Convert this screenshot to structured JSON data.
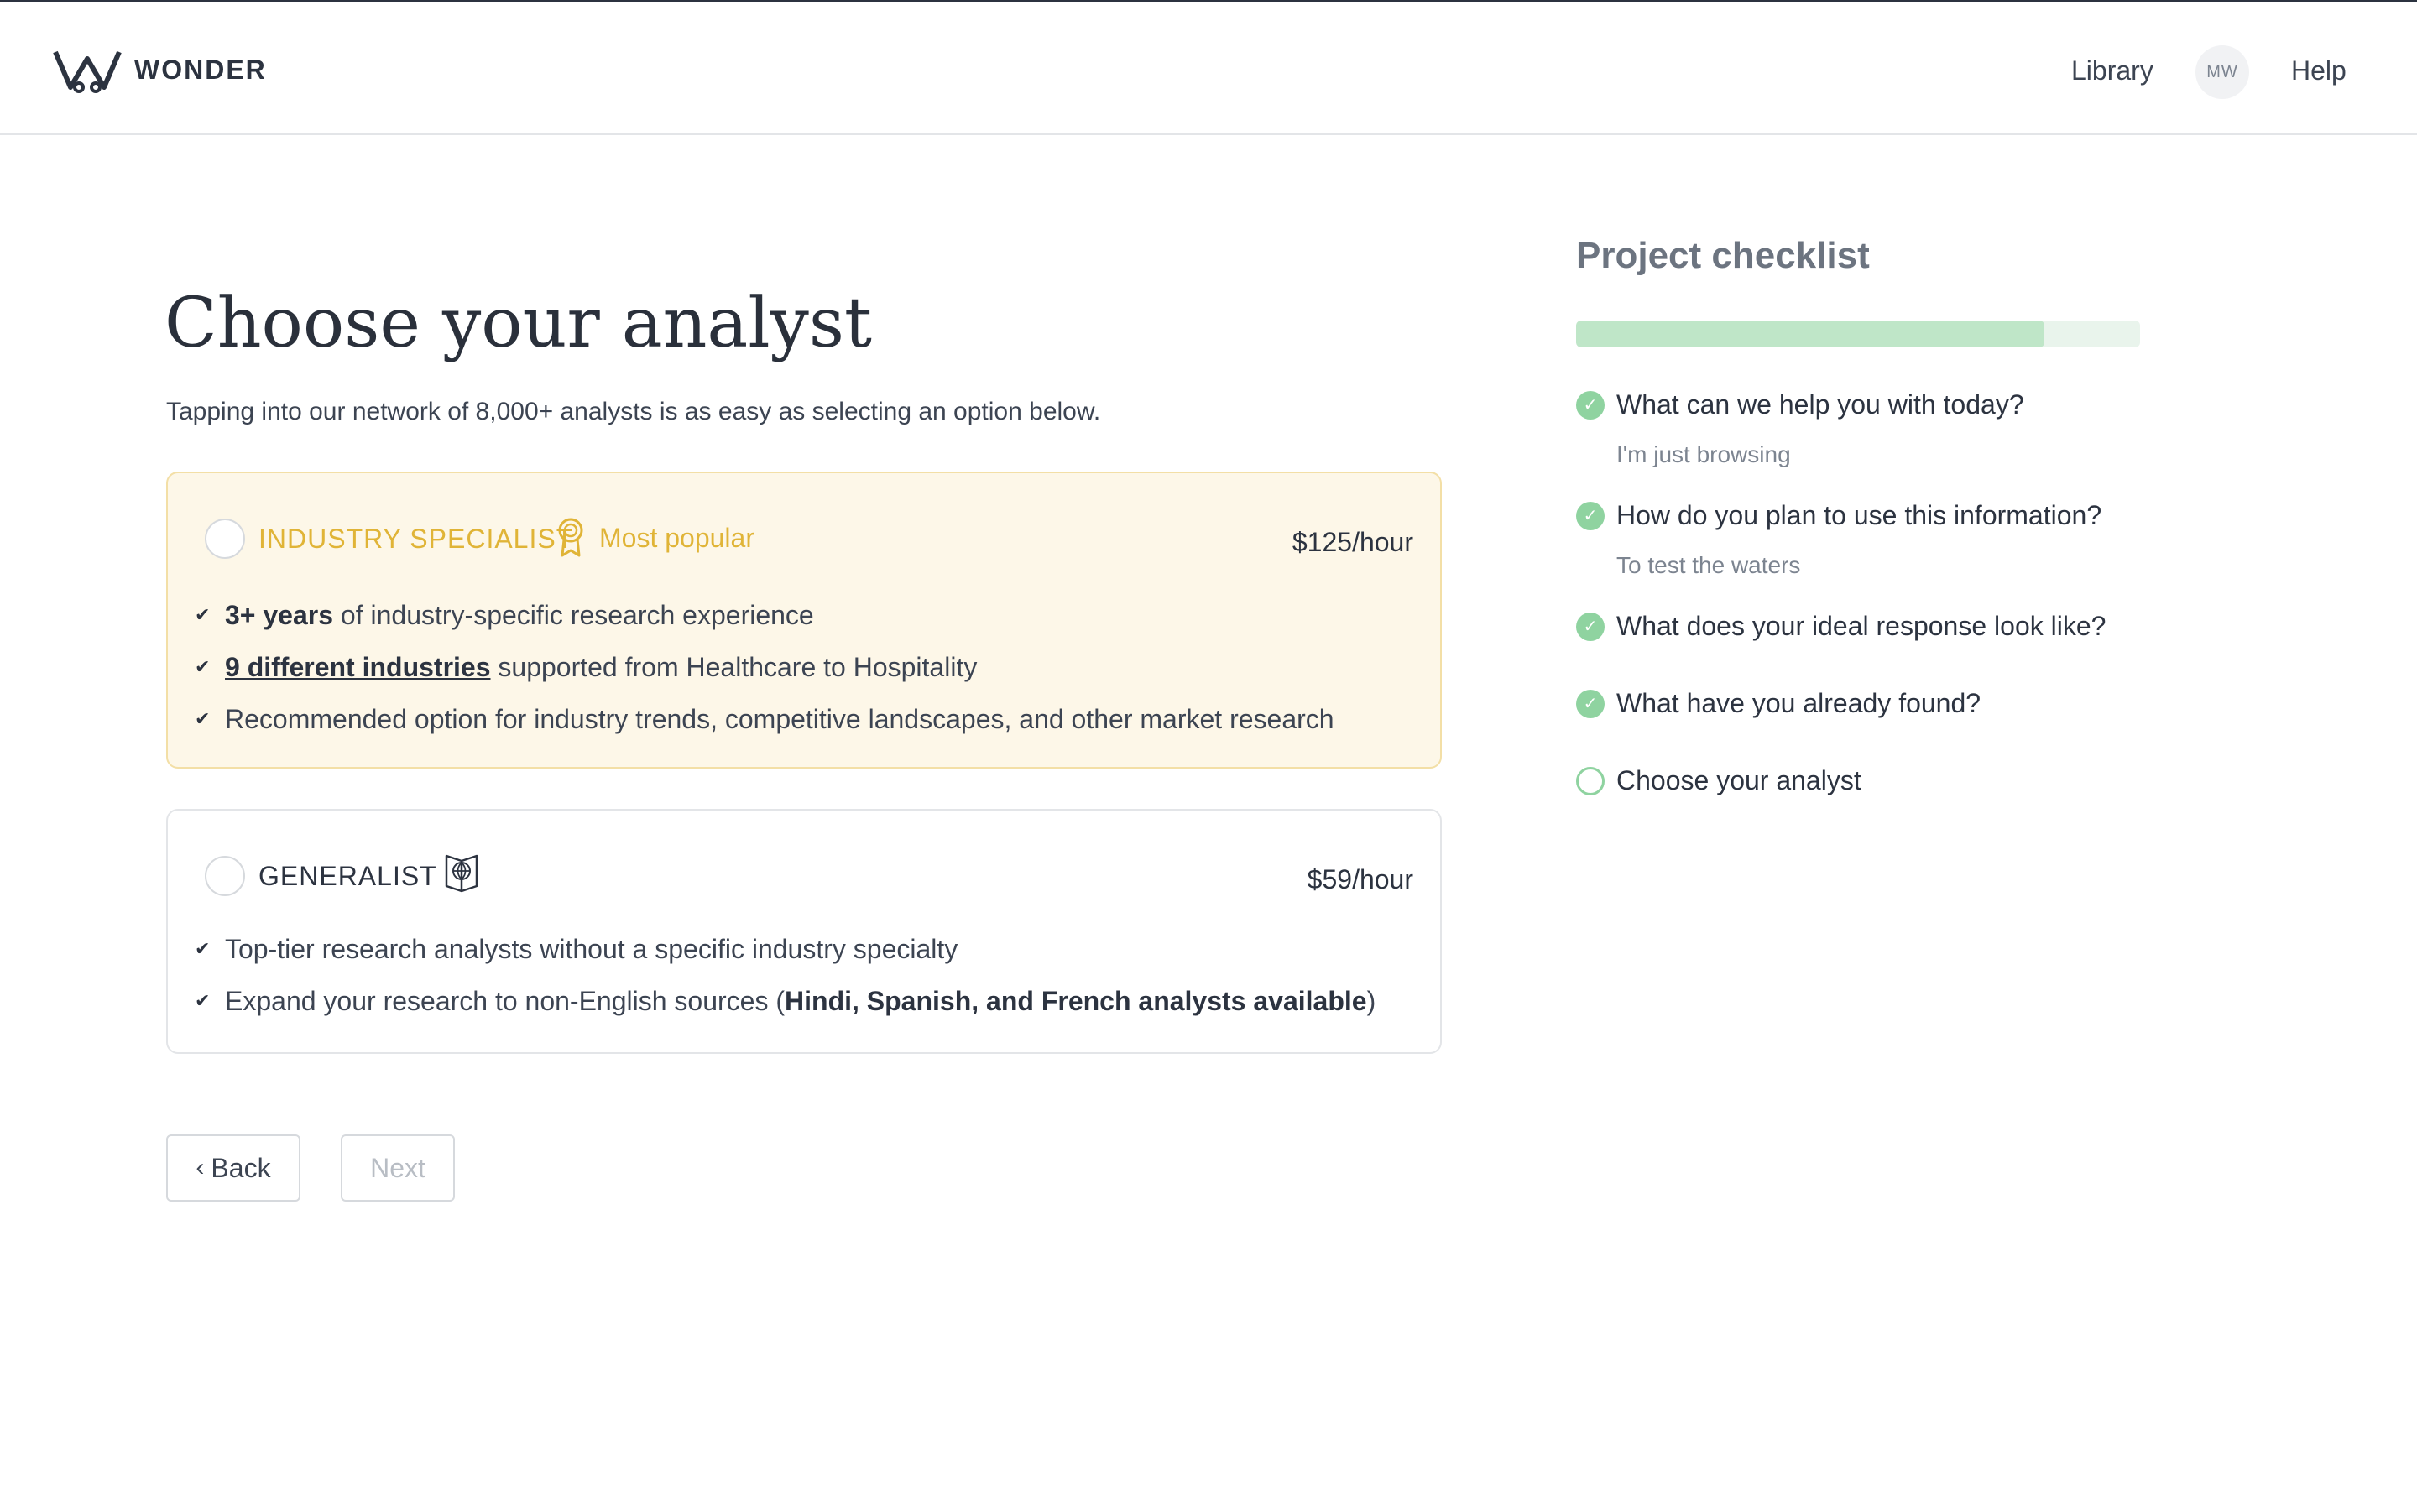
{
  "header": {
    "brand": "WONDER",
    "nav": {
      "library": "Library",
      "avatar_initials": "MW",
      "help": "Help"
    }
  },
  "main": {
    "title": "Choose your analyst",
    "subtitle": "Tapping into our network of 8,000+ analysts is as easy as selecting an option below.",
    "options": [
      {
        "title": "INDUSTRY SPECIALIST",
        "badge": "Most popular",
        "price": "$125/hour",
        "selected": false,
        "features": {
          "f1_bold": "3+ years",
          "f1_rest": " of industry-specific research experience",
          "f2_link": "9 different industries",
          "f2_rest": " supported from Healthcare to Hospitality",
          "f3": "Recommended option for industry trends, competitive landscapes, and other market research"
        }
      },
      {
        "title": "GENERALIST",
        "price": "$59/hour",
        "selected": false,
        "features": {
          "f1": "Top-tier research analysts without a specific industry specialty",
          "f2_pre": "Expand your research to non-English sources (",
          "f2_bold": "Hindi, Spanish, and French analysts available",
          "f2_post": ")"
        }
      }
    ],
    "buttons": {
      "back": "Back",
      "next": "Next"
    }
  },
  "checklist": {
    "title": "Project checklist",
    "progress": 0.83,
    "items": [
      {
        "question": "What can we help you with today?",
        "answer": "I'm just browsing",
        "done": true
      },
      {
        "question": "How do you plan to use this information?",
        "answer": "To test the waters",
        "done": true
      },
      {
        "question": "What does your ideal response look like?",
        "done": true
      },
      {
        "question": "What have you already found?",
        "done": true
      },
      {
        "question": "Choose your analyst",
        "done": false
      }
    ]
  },
  "colors": {
    "accent_gold": "#e0b437",
    "success_green": "#8fd3a0",
    "progress_fill": "#bfe6c8",
    "text_dark": "#2c3340"
  }
}
